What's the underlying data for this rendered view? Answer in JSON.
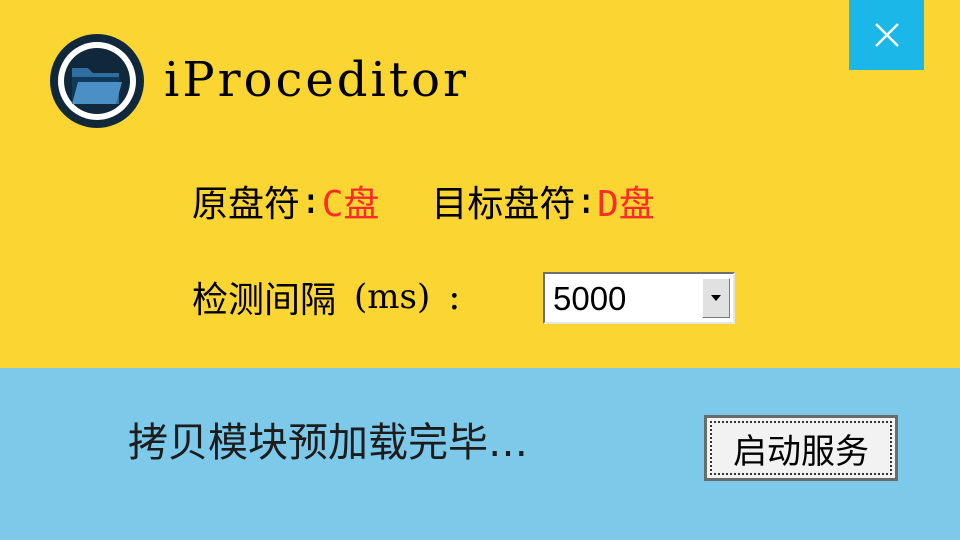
{
  "app": {
    "title": "iProceditor",
    "logo_icon": "folder-icon"
  },
  "window": {
    "close_icon": "close-icon",
    "colors": {
      "top_panel": "#FBD532",
      "bottom_panel": "#7DC9EA",
      "close_button": "#1AB7E8",
      "highlight_value": "#FF2A2A"
    }
  },
  "settings": {
    "source_drive_label": "原盘符",
    "source_drive_colon": ":",
    "source_drive_value": "C盘",
    "target_drive_label": "目标盘符",
    "target_drive_colon": ":",
    "target_drive_value": "D盘",
    "interval_label": "检测间隔",
    "interval_unit": "(ms)",
    "interval_colon": ":",
    "interval_value": "5000"
  },
  "status": {
    "message": "拷贝模块预加载完毕…"
  },
  "actions": {
    "start_service_label": "启动服务"
  }
}
